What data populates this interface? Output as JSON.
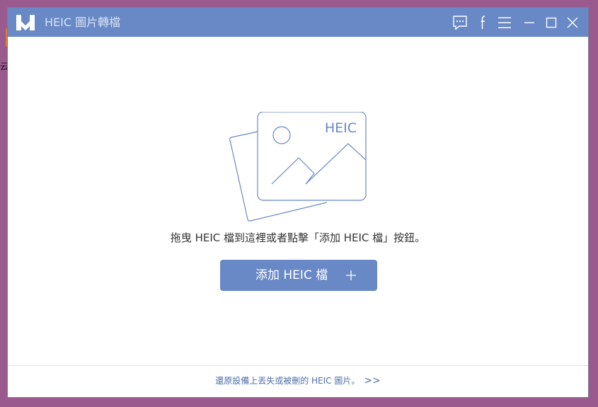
{
  "desktop": {
    "fragment_text": "云"
  },
  "window": {
    "title": "HEIC 圖片轉檔",
    "logo_icon": "heic-h-logo",
    "controls": [
      "feedback-icon",
      "facebook-icon",
      "menu-icon",
      "minimize-icon",
      "maximize-icon",
      "close-icon"
    ]
  },
  "main": {
    "illustration_text": "HEIC",
    "drop_hint": "拖曳 HEIC 檔到這裡或者點擊「添加 HEIC 檔」按鈕。",
    "add_button": {
      "label": "添加 HEIC 檔",
      "icon": "plus-icon"
    }
  },
  "footer": {
    "recover_link": "還原設備上丟失或被刪的 HEIC 圖片。",
    "recover_arrow": ">>"
  },
  "colors": {
    "accent": "#6889c5",
    "title_text": "#d7e2f4",
    "link": "#4e6ea8"
  }
}
